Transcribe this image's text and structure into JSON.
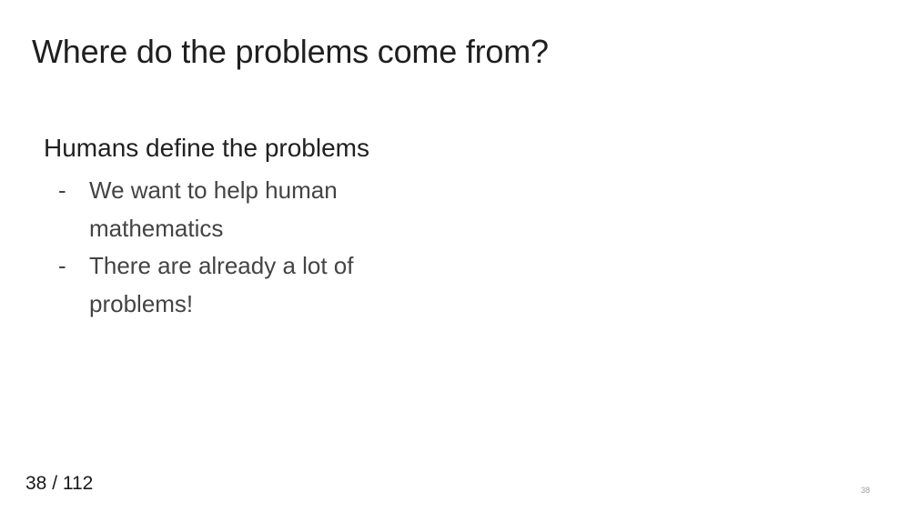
{
  "slide": {
    "title": "Where do the problems come from?",
    "heading": "Humans define the problems",
    "bullet_marker": "-",
    "bullets": [
      "We want to help human mathematics",
      "There are already a lot of problems!"
    ],
    "slide_number": "38"
  },
  "viewer": {
    "current_page": "38",
    "separator": " / ",
    "total_pages": "112"
  }
}
